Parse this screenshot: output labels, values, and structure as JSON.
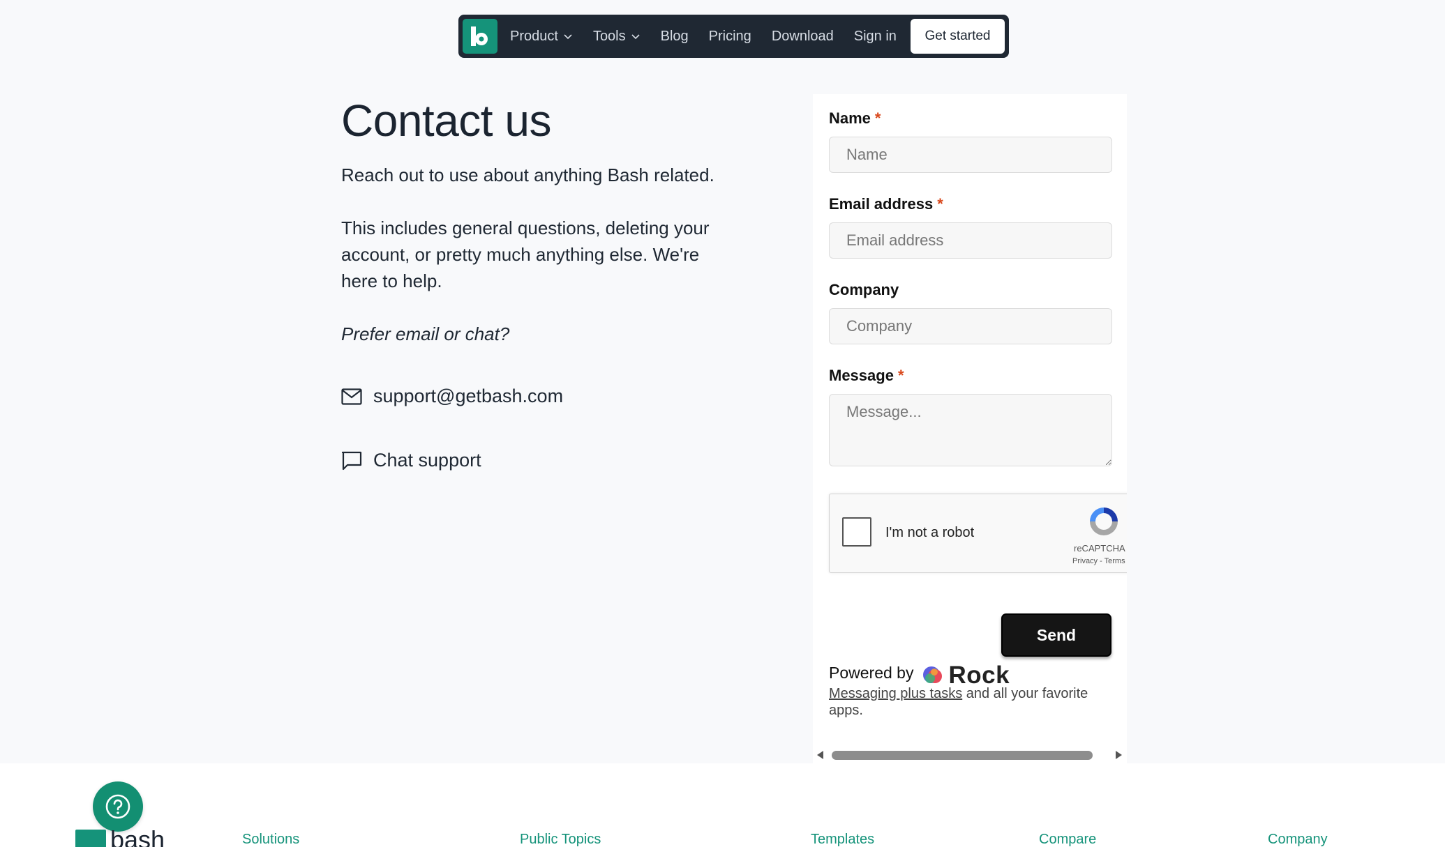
{
  "nav": {
    "items": [
      {
        "label": "Product",
        "dropdown": true
      },
      {
        "label": "Tools",
        "dropdown": true
      },
      {
        "label": "Blog"
      },
      {
        "label": "Pricing"
      },
      {
        "label": "Download"
      },
      {
        "label": "Sign in"
      }
    ],
    "cta": "Get started"
  },
  "main": {
    "title": "Contact us",
    "intro": "Reach out to use about anything Bash related.",
    "description": "This includes general questions, deleting your account, or pretty much anything else. We're here to help.",
    "prefer": "Prefer email or chat?",
    "email_link": "support@getbash.com",
    "chat_link": "Chat support",
    "email_icon": "mail-icon",
    "chat_icon": "chat-bubble-icon"
  },
  "form": {
    "required_marker": "*",
    "name": {
      "label": "Name",
      "placeholder": "Name",
      "value": ""
    },
    "email": {
      "label": "Email address",
      "placeholder": "Email address",
      "value": ""
    },
    "company": {
      "label": "Company",
      "placeholder": "Company",
      "value": ""
    },
    "message": {
      "label": "Message",
      "placeholder": "Message...",
      "value": ""
    },
    "captcha": {
      "label": "I'm not a robot",
      "brand": "reCAPTCHA",
      "links": "Privacy - Terms",
      "checked": false
    },
    "submit": "Send",
    "powered_by": "Powered by",
    "powered_brand": "Rock",
    "promo_link": "Messaging plus tasks",
    "promo_text": " and all your favorite apps."
  },
  "footer": {
    "brand": "bash",
    "columns": [
      "Solutions",
      "Public Topics",
      "Templates",
      "Compare",
      "Company"
    ]
  },
  "colors": {
    "brand_green": "#15937a",
    "nav_bg": "#1f2833",
    "required": "#d9481c",
    "send_bg": "#151515"
  }
}
